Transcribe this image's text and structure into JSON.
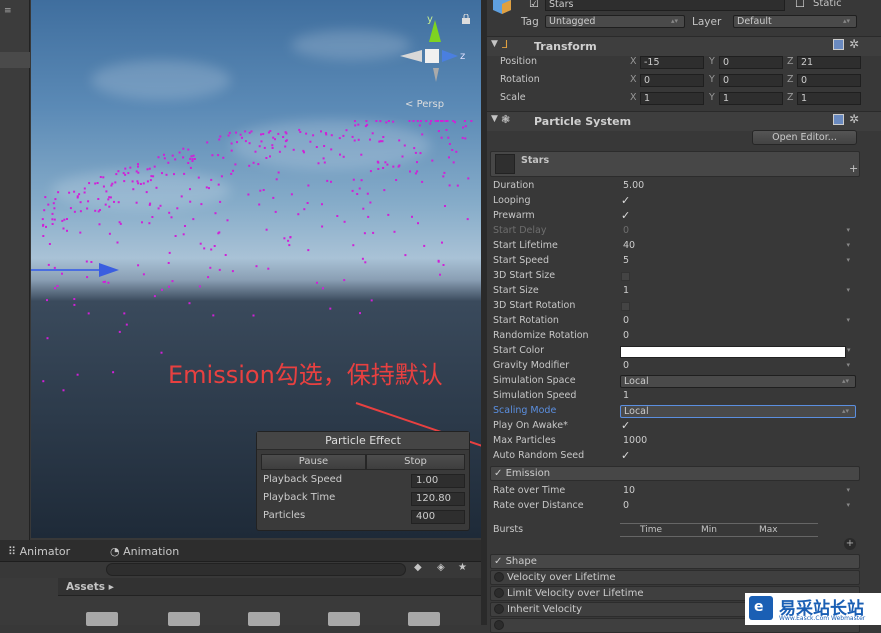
{
  "scene": {
    "left_menu": "≡",
    "persp_label": "Persp",
    "gizmo_y": "y",
    "gizmo_z": "z",
    "particle_effect": {
      "title": "Particle Effect",
      "pause_label": "Pause",
      "stop_label": "Stop",
      "rows": [
        {
          "label": "Playback Speed",
          "value": "1.00"
        },
        {
          "label": "Playback Time",
          "value": "120.80"
        },
        {
          "label": "Particles",
          "value": "400"
        }
      ]
    },
    "annotation": "Emission勾选，保持默认"
  },
  "bottom": {
    "tab_animator": "Animator",
    "tab_animation": "Animation",
    "assets_label": "Assets ▸"
  },
  "inspector": {
    "object_name": "Stars",
    "static_label": "Static",
    "tag_label": "Tag",
    "tag_value": "Untagged",
    "layer_label": "Layer",
    "layer_value": "Default",
    "transform": {
      "title": "Transform",
      "rows": [
        {
          "label": "Position",
          "x": "-15",
          "y": "0",
          "z": "21"
        },
        {
          "label": "Rotation",
          "x": "0",
          "y": "0",
          "z": "0"
        },
        {
          "label": "Scale",
          "x": "1",
          "y": "1",
          "z": "1"
        }
      ],
      "axis_x": "X",
      "axis_y": "Y",
      "axis_z": "Z"
    },
    "particle_system": {
      "title": "Particle System",
      "open_editor": "Open Editor...",
      "system_name": "Stars",
      "props": [
        {
          "label": "Duration",
          "value": "5.00",
          "type": "text"
        },
        {
          "label": "Looping",
          "value": "✓",
          "type": "check"
        },
        {
          "label": "Prewarm",
          "value": "✓",
          "type": "check"
        },
        {
          "label": "Start Delay",
          "value": "0",
          "type": "dim"
        },
        {
          "label": "Start Lifetime",
          "value": "40",
          "type": "dd"
        },
        {
          "label": "Start Speed",
          "value": "5",
          "type": "dd"
        },
        {
          "label": "3D Start Size",
          "value": "",
          "type": "box"
        },
        {
          "label": "Start Size",
          "value": "1",
          "type": "dd"
        },
        {
          "label": "3D Start Rotation",
          "value": "",
          "type": "box"
        },
        {
          "label": "Start Rotation",
          "value": "0",
          "type": "dd"
        },
        {
          "label": "Randomize Rotation",
          "value": "0",
          "type": "text"
        },
        {
          "label": "Start Color",
          "value": "",
          "type": "color"
        },
        {
          "label": "Gravity Modifier",
          "value": "0",
          "type": "dd"
        },
        {
          "label": "Simulation Space",
          "value": "Local",
          "type": "select"
        },
        {
          "label": "Simulation Speed",
          "value": "1",
          "type": "text"
        },
        {
          "label": "Scaling Mode",
          "value": "Local",
          "type": "select"
        },
        {
          "label": "Play On Awake*",
          "value": "✓",
          "type": "check"
        },
        {
          "label": "Max Particles",
          "value": "1000",
          "type": "text"
        },
        {
          "label": "Auto Random Seed",
          "value": "✓",
          "type": "check"
        }
      ],
      "emission": {
        "title": "Emission",
        "rows": [
          {
            "label": "Rate over Time",
            "value": "10"
          },
          {
            "label": "Rate over Distance",
            "value": "0"
          }
        ],
        "bursts_label": "Bursts",
        "bursts_cols": [
          "Time",
          "Min",
          "Max"
        ]
      },
      "modules": [
        {
          "label": "Shape",
          "checked": true
        },
        {
          "label": "Velocity over Lifetime",
          "checked": false
        },
        {
          "label": "Limit Velocity over Lifetime",
          "checked": false
        },
        {
          "label": "Inherit Velocity",
          "checked": false
        }
      ]
    }
  },
  "watermark": {
    "text": "易采站长站",
    "sub": "Www.Easck.Com Webmaster"
  },
  "colors": {
    "particle": "#d020d8",
    "annotation": "#e84040",
    "scaling_mode_label": "#5b8fe0",
    "watermark_blue": "#1a5fb4"
  }
}
